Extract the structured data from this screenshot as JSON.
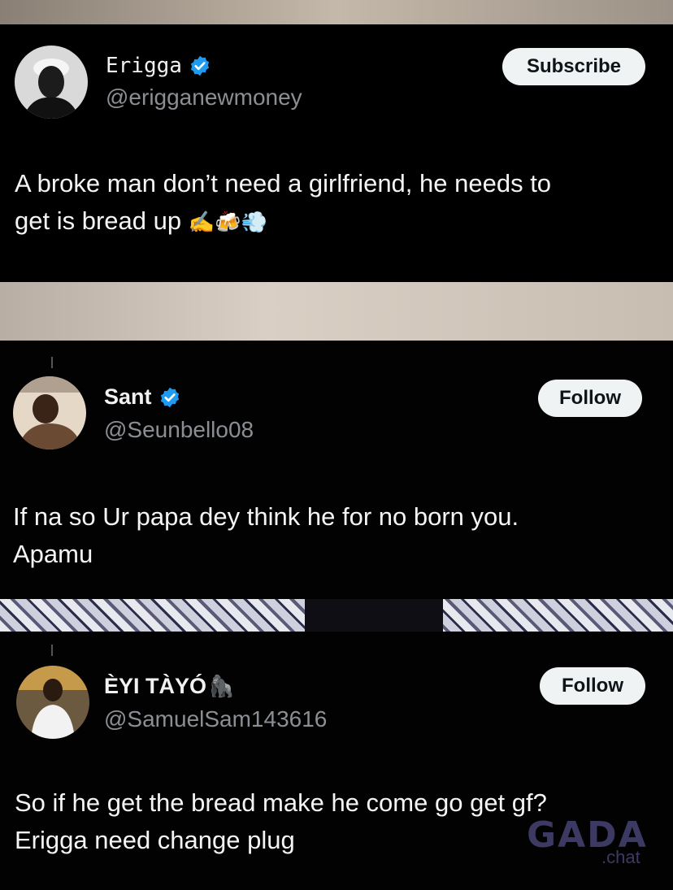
{
  "posts": [
    {
      "name": "Erigga",
      "handle": "@erigganewmoney",
      "action": "Subscribe",
      "text_line1": "A broke man don’t need a girlfriend, he needs to",
      "text_line2": "get is bread up",
      "emojis": "✍️🍻💨"
    },
    {
      "name": "Sant",
      "handle": "@Seunbello08",
      "action": "Follow",
      "text_line1": "If na so Ur papa dey think he for no born you.",
      "text_line2": "Apamu"
    },
    {
      "name": "ÈYI TÀYÓ",
      "name_emoji": "🦍",
      "handle": "@SamuelSam143616",
      "action": "Follow",
      "text_line1": "So if he get the bread make he come go get gf?",
      "text_line2": "Erigga need change plug"
    }
  ],
  "watermark": {
    "brand": "GADA",
    "suffix": ".chat"
  },
  "colors": {
    "verified": "#1d9bf0",
    "handle": "#8b8f94",
    "pill_bg": "#eff3f4"
  }
}
